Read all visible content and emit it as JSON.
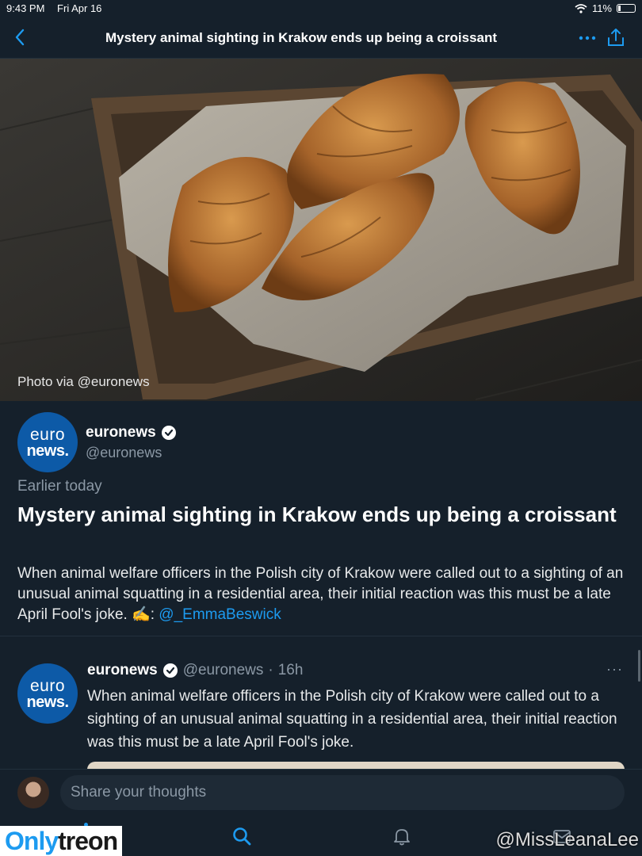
{
  "status_bar": {
    "time": "9:43 PM",
    "date": "Fri Apr 16",
    "battery": "11%"
  },
  "nav": {
    "title": "Mystery animal sighting in Krakow ends up being a croissant"
  },
  "hero": {
    "credit": "Photo via @euronews"
  },
  "article": {
    "author_name": "euronews",
    "author_handle": "@euronews",
    "avatar_line1": "euro",
    "avatar_line2": "news.",
    "time": "Earlier today",
    "headline": "Mystery animal sighting in Krakow ends up being a croissant",
    "summary_text": "When animal welfare officers in the Polish city of Krakow were called out to a sighting of an unusual animal squatting in a residential area, their initial reaction was this must be a late April Fool's joke. ✍️: ",
    "summary_link": "@_EmmaBeswick"
  },
  "tweet": {
    "name": "euronews",
    "handle": "@euronews",
    "separator": "·",
    "age": "16h",
    "more": "···",
    "body": "When animal welfare officers in the Polish city of Krakow were called out to a sighting of an unusual animal squatting in a residential area, their initial reaction was this must be a late April Fool's joke."
  },
  "compose": {
    "placeholder": "Share your thoughts"
  },
  "watermark": {
    "left_a": "Only",
    "left_b": "treon",
    "right": "@MissLeanaLee"
  },
  "colors": {
    "background": "#15202b",
    "accent": "#1d9bf0",
    "brand_blue": "#0d5aa7",
    "muted": "#8b98a5"
  },
  "icons": [
    "back-chevron-icon",
    "more-dots-icon",
    "share-icon",
    "verified-icon",
    "search-icon",
    "bell-icon",
    "mail-icon",
    "wifi-icon",
    "battery-icon"
  ]
}
